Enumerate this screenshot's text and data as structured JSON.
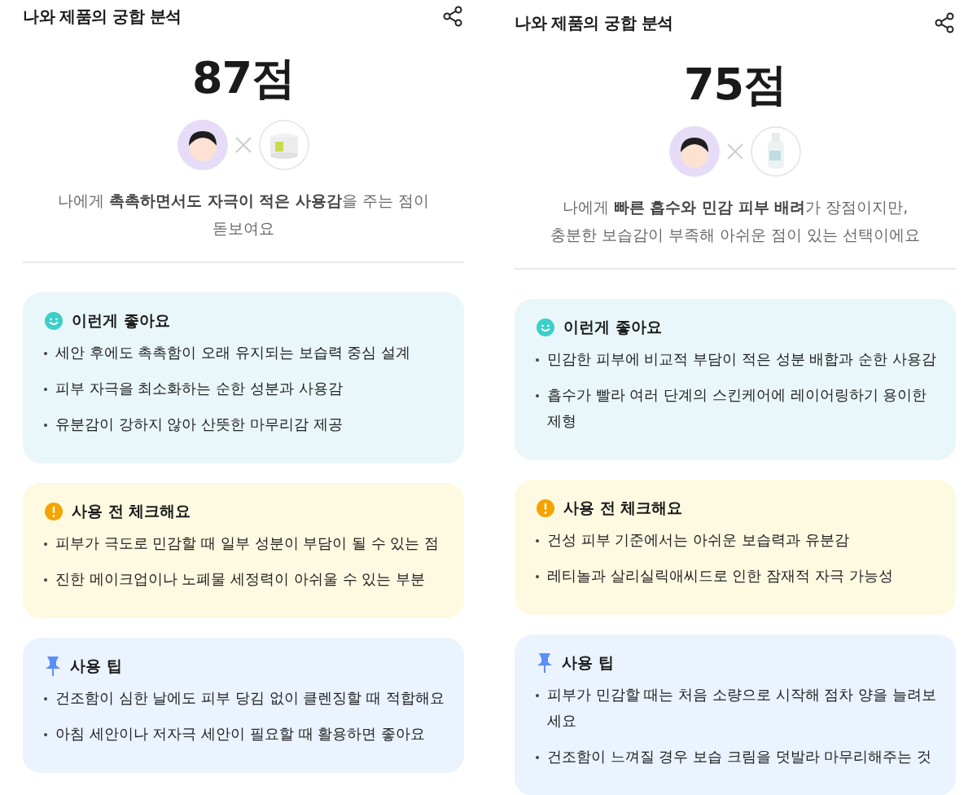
{
  "panels": [
    {
      "title": "나와 제품의 궁합 분석",
      "score": "87점",
      "summary": "나에게 **촉촉하면서도 자극이 적은 사용감**을 주는 점이 돋보여요",
      "sections": [
        {
          "kind": "good",
          "title": "이런게 좋아요",
          "items": [
            "세안 후에도 촉촉함이 오래 유지되는 보습력 중심 설계",
            "피부 자극을 최소화하는 순한 성분과 사용감",
            "유분감이 강하지 않아 산뜻한 마무리감 제공"
          ]
        },
        {
          "kind": "check",
          "title": "사용 전 체크해요",
          "items": [
            "피부가 극도로 민감할 때 일부 성분이 부담이 될 수 있는 점",
            "진한 메이크업이나 노폐물 세정력이 아쉬울 수 있는 부분"
          ]
        },
        {
          "kind": "tip",
          "title": "사용 팁",
          "items": [
            "건조함이 심한 날에도 피부 당김 없이 클렌징할 때 적합해요",
            "아침 세안이나 저자극 세안이 필요할 때 활용하면 좋아요"
          ]
        }
      ]
    },
    {
      "title": "나와 제품의 궁합 분석",
      "score": "75점",
      "summary": "나에게 **빠른 흡수와 민감 피부 배려**가 장점이지만, 충분한 보습감이 부족해 아쉬운 점이 있는 선택이에요",
      "sections": [
        {
          "kind": "good",
          "title": "이런게 좋아요",
          "items": [
            "민감한 피부에 비교적 부담이 적은 성분 배합과 순한 사용감",
            "흡수가 빨라 여러 단계의 스킨케어에 레이어링하기 용이한 제형"
          ]
        },
        {
          "kind": "check",
          "title": "사용 전 체크해요",
          "items": [
            "건성 피부 기준에서는 아쉬운 보습력과 유분감",
            "레티놀과 살리실릭애씨드로 인한 잠재적 자극 가능성"
          ]
        },
        {
          "kind": "tip",
          "title": "사용 팁",
          "items": [
            "피부가 민감할 때는 처음 소량으로 시작해 점차 양을 늘려보세요",
            "건조함이 느껴질 경우 보습 크림을 덧발라 마무리해주는 것"
          ]
        }
      ]
    }
  ]
}
